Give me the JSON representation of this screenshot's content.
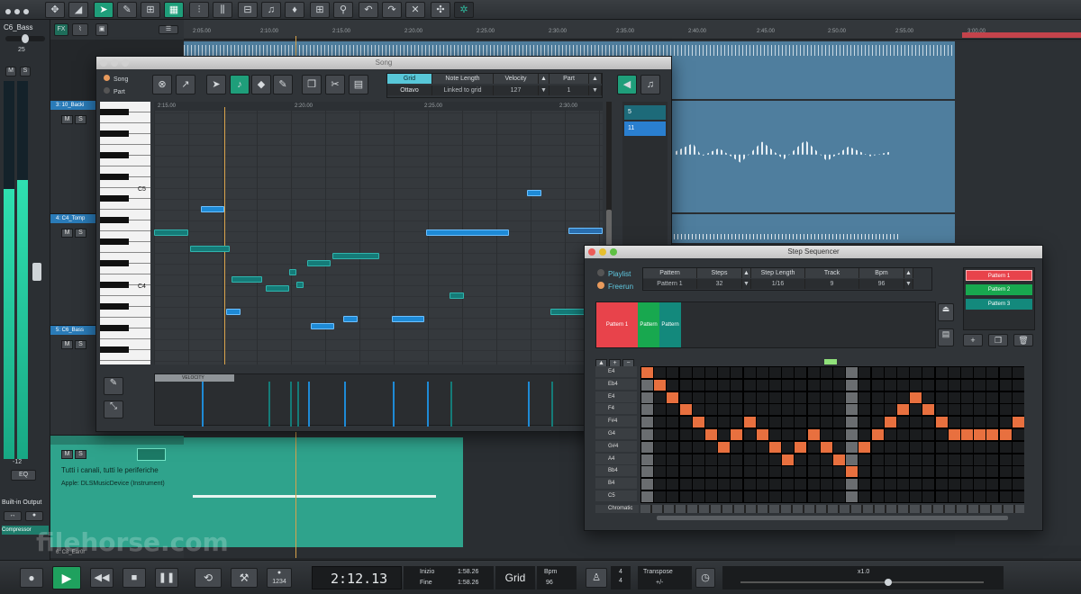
{
  "toolbar": {
    "tools": [
      "move-icon",
      "range-icon",
      "pointer-icon",
      "pencil-icon",
      "snap-icon",
      "mixer-icon",
      "fader-icon",
      "split-icon",
      "quantize-icon",
      "metronome-icon",
      "undo-icon",
      "redo-icon",
      "magic-icon",
      "fx-icon",
      "network-icon"
    ]
  },
  "channel": {
    "name": "C6_Bass",
    "value": "25",
    "m": "M",
    "s": "S",
    "level": "-12",
    "eq": "EQ",
    "output": "Built-in Output",
    "plugin": "Compressor",
    "fx": "FX"
  },
  "tracks": [
    {
      "name": "3: 10_Backi",
      "m": "M",
      "s": "S"
    },
    {
      "name": "4: C4_Tomp",
      "m": "M",
      "s": "S"
    },
    {
      "name": "5: C6_Bass",
      "m": "M",
      "s": "S"
    },
    {
      "name": "6: C8_Ear0r",
      "m": "M",
      "s": "S"
    }
  ],
  "instrument": {
    "line1": "Tutti i canali, tutti le periferiche",
    "line2": "Apple: DLSMusicDevice (Instrument)"
  },
  "timeline": {
    "marks": [
      "2:05.00",
      "2:10.00",
      "2:15.00",
      "2:20.00",
      "2:25.00",
      "2:30.00",
      "2:35.00",
      "2:40.00",
      "2:45.00",
      "2:50.00",
      "2:55.00",
      "3:00.00"
    ]
  },
  "song_window": {
    "title": "Song",
    "modes": [
      "Song",
      "Part"
    ],
    "params": [
      {
        "h": "Grid",
        "v": "Ottavo"
      },
      {
        "h": "Note Length",
        "v": "Linked to grid"
      },
      {
        "h": "Velocity",
        "v": "127"
      },
      {
        "h": "Part",
        "v": "1"
      }
    ],
    "keys": {
      "c5": "C5",
      "c4": "C4"
    },
    "velocity_label": "VELOCITY",
    "ruler": [
      "2:15.00",
      "2:20.00",
      "2:25.00",
      "2:30.00"
    ],
    "part_numbers": [
      "5",
      "11"
    ]
  },
  "step_seq": {
    "title": "Step Sequencer",
    "modes": [
      "Playlist",
      "Freerun"
    ],
    "params": [
      {
        "h": "Pattern",
        "v": "Pattern 1"
      },
      {
        "h": "Steps",
        "v": "32"
      },
      {
        "h": "Step Length",
        "v": "1/16"
      },
      {
        "h": "Track",
        "v": "9"
      },
      {
        "h": "Bpm",
        "v": "96"
      }
    ],
    "patterns": [
      {
        "name": "Pattern 1",
        "color": "#e8434b"
      },
      {
        "name": "Pattern 2",
        "color": "#18a84f"
      },
      {
        "name": "Pattern 3",
        "color": "#13897c"
      }
    ],
    "blocks": [
      {
        "label": "Pattern 1"
      },
      {
        "label": "Pattern 2"
      },
      {
        "label": "Pattern 3"
      }
    ],
    "rows": [
      "E4",
      "Eb4",
      "E4",
      "F4",
      "F#4",
      "G4",
      "G#4",
      "A4",
      "Bb4",
      "B4",
      "C5"
    ],
    "footer": "Chromatic",
    "steps": [
      [
        0,
        0
      ],
      [
        1,
        1
      ],
      [
        2,
        2
      ],
      [
        3,
        3
      ],
      [
        4,
        4
      ],
      [
        5,
        5
      ],
      [
        6,
        6
      ],
      [
        7,
        5
      ],
      [
        8,
        4
      ],
      [
        9,
        5
      ],
      [
        10,
        6
      ],
      [
        11,
        7
      ],
      [
        12,
        6
      ],
      [
        13,
        5
      ],
      [
        14,
        6
      ],
      [
        15,
        7
      ],
      [
        16,
        8
      ],
      [
        17,
        6
      ],
      [
        18,
        5
      ],
      [
        19,
        4
      ],
      [
        20,
        3
      ],
      [
        21,
        2
      ],
      [
        22,
        3
      ],
      [
        23,
        4
      ],
      [
        24,
        5
      ],
      [
        25,
        5
      ],
      [
        26,
        5
      ],
      [
        27,
        5
      ],
      [
        28,
        5
      ],
      [
        29,
        4
      ],
      [
        30,
        3
      ]
    ]
  },
  "transport": {
    "time": "2:12.13",
    "inizio": "Inizio",
    "fine": "Fine",
    "inizio_val": "1:58.26",
    "fine_val": "1:58.26",
    "grid": "Grid",
    "bpm_label": "Bpm",
    "bpm": "96",
    "sig_top": "4",
    "sig_bot": "4",
    "transpose": "Transpose",
    "transpose_val": "+/-",
    "zoom": "x1.0",
    "counter": "1234"
  },
  "watermark": "filehorse.com"
}
